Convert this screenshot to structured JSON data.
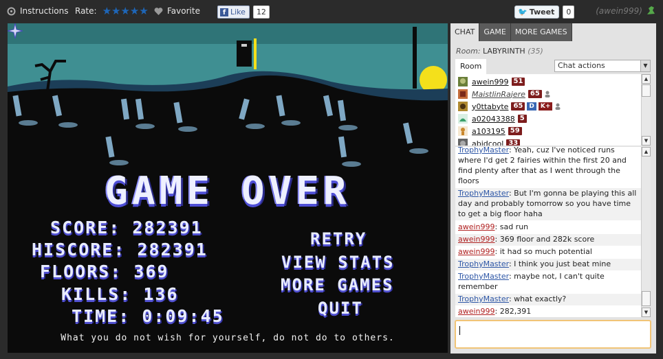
{
  "topbar": {
    "instructions_label": "Instructions",
    "rate_label": "Rate:",
    "stars": "★★★★★",
    "favorite_label": "Favorite",
    "like_label": "Like",
    "like_count": "12",
    "tweet_label": "Tweet",
    "tweet_count": "0",
    "username": "(awein999)"
  },
  "game": {
    "title": "GAME OVER",
    "stats": [
      {
        "label": "SCORE:",
        "value": "282391"
      },
      {
        "label": "HISCORE:",
        "value": "282391"
      },
      {
        "label": "FLOORS:",
        "value": "369"
      },
      {
        "label": "KILLS:",
        "value": "136"
      },
      {
        "label": "TIME:",
        "value": "0:09:45"
      }
    ],
    "menu": [
      "RETRY",
      "VIEW STATS",
      "MORE GAMES",
      "QUIT"
    ],
    "quote": "What you do not wish for yourself, do not do to others."
  },
  "panel": {
    "tabs": [
      "CHAT",
      "GAME",
      "MORE GAMES"
    ],
    "room_label": "Room:",
    "room_name": "LABYRINTH",
    "room_count": "(35)",
    "room_tab": "Room",
    "chat_actions": "Chat actions",
    "users": [
      {
        "name": "awein999",
        "level": "51"
      },
      {
        "name": "MaistlinRajere",
        "level": "65"
      },
      {
        "name": "y0ttabyte",
        "level": "65",
        "badges": [
          "D",
          "K+"
        ]
      },
      {
        "name": "a02043388",
        "level": "5"
      },
      {
        "name": "a103195",
        "level": "59"
      },
      {
        "name": "abidcool",
        "level": "33"
      }
    ],
    "messages": [
      {
        "from": "TrophyMaster",
        "text": "Yeah, cuz I've noticed runs where I'd get 2 fairies within the first 20 and find plenty after that as I went through the floors"
      },
      {
        "from": "TrophyMaster",
        "text": "But I'm gonna be playing this all day and probably tomorrow so you have time to get a big floor haha"
      },
      {
        "from": "awein999",
        "text": "sad run"
      },
      {
        "from": "awein999",
        "text": "369 floor and 282k score"
      },
      {
        "from": "awein999",
        "text": "it had so much potential"
      },
      {
        "from": "TrophyMaster",
        "text": "I think you just beat mine"
      },
      {
        "from": "TrophyMaster",
        "text": "maybe not, I can't quite remember"
      },
      {
        "from": "TrophyMaster",
        "text": "what exactly?"
      },
      {
        "from": "awein999",
        "text": "282,391"
      }
    ]
  },
  "colors": {
    "accent_blue": "#1e66b8",
    "level_badge": "#7d1d1d",
    "trophy_name": "#2c55a5",
    "awein_name": "#b02020"
  }
}
